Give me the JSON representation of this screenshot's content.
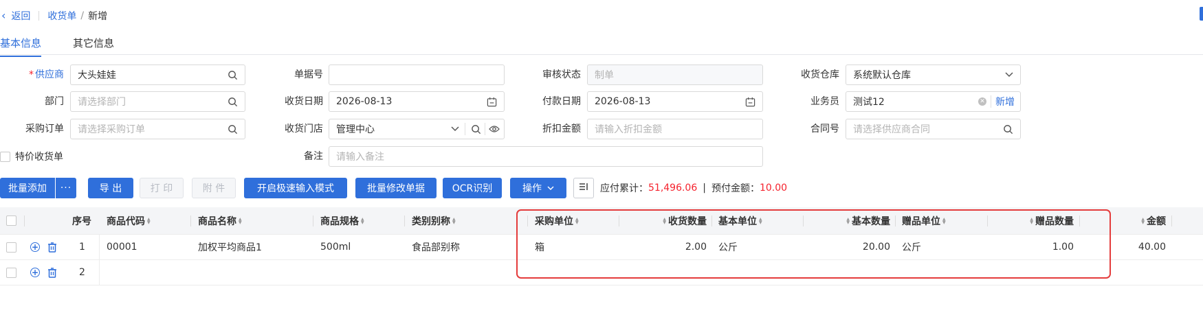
{
  "header": {
    "back_label": "返回",
    "breadcrumb_parent": "收货单",
    "breadcrumb_sep": "/",
    "breadcrumb_current": "新增"
  },
  "tabs": [
    {
      "label": "基本信息",
      "active": true
    },
    {
      "label": "其它信息",
      "active": false
    }
  ],
  "form": {
    "supplier": {
      "label": "供应商",
      "required": "*",
      "value": "大头娃娃"
    },
    "doc_no": {
      "label": "单据号",
      "value": ""
    },
    "audit_status": {
      "label": "审核状态",
      "placeholder": "制单"
    },
    "warehouse": {
      "label": "收货仓库",
      "value": "系统默认仓库"
    },
    "department": {
      "label": "部门",
      "placeholder": "请选择部门"
    },
    "receive_date": {
      "label": "收货日期",
      "value": "2026-08-13"
    },
    "pay_date": {
      "label": "付款日期",
      "value": "2026-08-13"
    },
    "salesman": {
      "label": "业务员",
      "value": "测试12",
      "add_label": "新增"
    },
    "purchase_order": {
      "label": "采购订单",
      "placeholder": "请选择采购订单"
    },
    "store": {
      "label": "收货门店",
      "value": "管理中心"
    },
    "discount": {
      "label": "折扣金额",
      "placeholder": "请输入折扣金额"
    },
    "contract": {
      "label": "合同号",
      "placeholder": "请选择供应商合同"
    },
    "special_price": {
      "label": "特价收货单"
    },
    "remark": {
      "label": "备注",
      "placeholder": "请输入备注"
    }
  },
  "toolbar": {
    "batch_add": "批量添加",
    "more": "···",
    "export": "导 出",
    "print": "打 印",
    "attach": "附 件",
    "fast_input": "开启极速输入模式",
    "batch_edit": "批量修改单据",
    "ocr": "OCR识别",
    "operate": "操作"
  },
  "summary": {
    "payable_label": "应付累计：",
    "payable_value": "51,496.06",
    "divider": "|",
    "prepaid_label": "预付金额：",
    "prepaid_value": "10.00"
  },
  "grid": {
    "headers": {
      "seq": "序号",
      "code": "商品代码",
      "name": "商品名称",
      "spec": "商品规格",
      "category": "类别别称",
      "purchase_unit": "采购单位",
      "recv_qty": "收货数量",
      "base_unit": "基本单位",
      "base_qty": "基本数量",
      "gift_unit": "赠品单位",
      "gift_qty": "赠品数量",
      "amount": "金额"
    },
    "rows": [
      {
        "seq": "1",
        "code": "00001",
        "name": "加权平均商品1",
        "spec": "500ml",
        "category": "食品部别称",
        "purchase_unit": "箱",
        "recv_qty": "2.00",
        "base_unit": "公斤",
        "base_qty": "20.00",
        "gift_unit": "公斤",
        "gift_qty": "1.00",
        "amount": "40.00"
      },
      {
        "seq": "2",
        "code": "",
        "name": "",
        "spec": "",
        "category": "",
        "purchase_unit": "",
        "recv_qty": "",
        "base_unit": "",
        "base_qty": "",
        "gift_unit": "",
        "gift_qty": "",
        "amount": ""
      }
    ]
  },
  "colors": {
    "primary": "#2f6fdb",
    "danger": "#f5222d",
    "highlight_box": "#e43b3b"
  }
}
